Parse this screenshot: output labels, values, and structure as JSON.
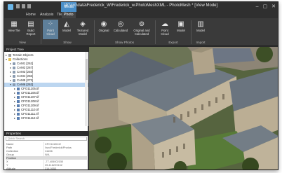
{
  "window": {
    "title": "W:\\src\\data\\Frederick_W\\Frederick_w.PhotoMeshXML - PhotoMesh * [View Mode]",
    "context_tab": "Media",
    "controls": [
      "–",
      "▢",
      "✕"
    ]
  },
  "ribbon_tabs": [
    "Home",
    "Analysis",
    "Tile",
    "Photo"
  ],
  "active_tab": "Photo",
  "ribbon": {
    "buttons": [
      {
        "label": "View Tile",
        "icon": "tile-view-icon",
        "selected": false
      },
      {
        "label": "Build Report",
        "icon": "report-icon",
        "selected": false
      },
      {
        "label": "Point Cloud",
        "icon": "point-cloud-icon",
        "selected": true
      },
      {
        "label": "Model",
        "icon": "model-icon",
        "selected": false
      },
      {
        "label": "Textured Model",
        "icon": "textured-model-icon",
        "selected": false
      },
      {
        "label": "Original",
        "icon": "camera-original-icon",
        "selected": false
      },
      {
        "label": "Calculated",
        "icon": "camera-calculated-icon",
        "selected": false
      },
      {
        "label": "Original and Calculated",
        "icon": "camera-both-icon",
        "selected": false
      },
      {
        "label": "Point Cloud",
        "icon": "export-point-cloud-icon",
        "selected": false
      },
      {
        "label": "Model",
        "icon": "export-model-icon",
        "selected": false
      },
      {
        "label": "Model",
        "icon": "import-model-icon",
        "selected": false
      }
    ],
    "groups": [
      "View",
      "Show",
      "Show Photos",
      "Export",
      "Import"
    ]
  },
  "project_tree": {
    "header": "Project Tree",
    "items": [
      {
        "label": "Terrain Objects",
        "level": 0,
        "icon": "objects-icon",
        "expanded": false
      },
      {
        "label": "Collections",
        "level": 0,
        "icon": "folder-icon",
        "expanded": true
      },
      {
        "label": "CAM1 [262]",
        "level": 1,
        "icon": "camera-icon",
        "expanded": false
      },
      {
        "label": "CAM2 [267]",
        "level": 1,
        "icon": "camera-icon",
        "expanded": false
      },
      {
        "label": "CAM3 [255]",
        "level": 1,
        "icon": "camera-icon",
        "expanded": false
      },
      {
        "label": "CAM4 [256]",
        "level": 1,
        "icon": "camera-icon",
        "expanded": false
      },
      {
        "label": "CAM5 [273]",
        "level": 1,
        "icon": "camera-icon",
        "expanded": false
      },
      {
        "label": "CAM6 [262]",
        "level": 1,
        "icon": "camera-icon",
        "expanded": true,
        "selected": true
      },
      {
        "label": "CFO11105.tif",
        "level": 2,
        "icon": "image-icon"
      },
      {
        "label": "CFO11106.tif",
        "level": 2,
        "icon": "image-icon"
      },
      {
        "label": "CFO11107.tif",
        "level": 2,
        "icon": "image-icon"
      },
      {
        "label": "CFO11108.tif",
        "level": 2,
        "icon": "image-icon"
      },
      {
        "label": "CFO11109.tif",
        "level": 2,
        "icon": "image-icon"
      },
      {
        "label": "CFO11110.tif",
        "level": 2,
        "icon": "image-icon"
      },
      {
        "label": "CFO11111.tif",
        "level": 2,
        "icon": "image-icon"
      },
      {
        "label": "CFO11112.tif",
        "level": 2,
        "icon": "image-icon"
      }
    ]
  },
  "properties": {
    "header": "Properties",
    "search_placeholder": "Quick Search",
    "rows_top": [
      {
        "key": "Name",
        "value": "CFO11106.tif"
      },
      {
        "key": "Path",
        "value": "\\\\src\\Frederick\\Photos"
      },
      {
        "key": "Collection",
        "value": "CAM6"
      },
      {
        "key": "Group",
        "value": "N/A"
      }
    ],
    "section": "Position",
    "rows_bottom": [
      {
        "key": "X",
        "value": "-77.405002150"
      },
      {
        "key": "Y",
        "value": "39.416229132"
      },
      {
        "key": "Altitude",
        "value": "314.0053"
      },
      {
        "key": "Yaw",
        "value": "-2.901821"
      },
      {
        "key": "Omega",
        "value": "3.287361"
      },
      {
        "key": "Phi",
        "value": "0.1231"
      }
    ]
  },
  "viewport": {
    "description_colors": {
      "sky": "#6b7a57",
      "roof": "#6f7b86",
      "stone": "#b8aa92",
      "grass": "#4f6b35",
      "trees": "#3a4a27"
    }
  }
}
